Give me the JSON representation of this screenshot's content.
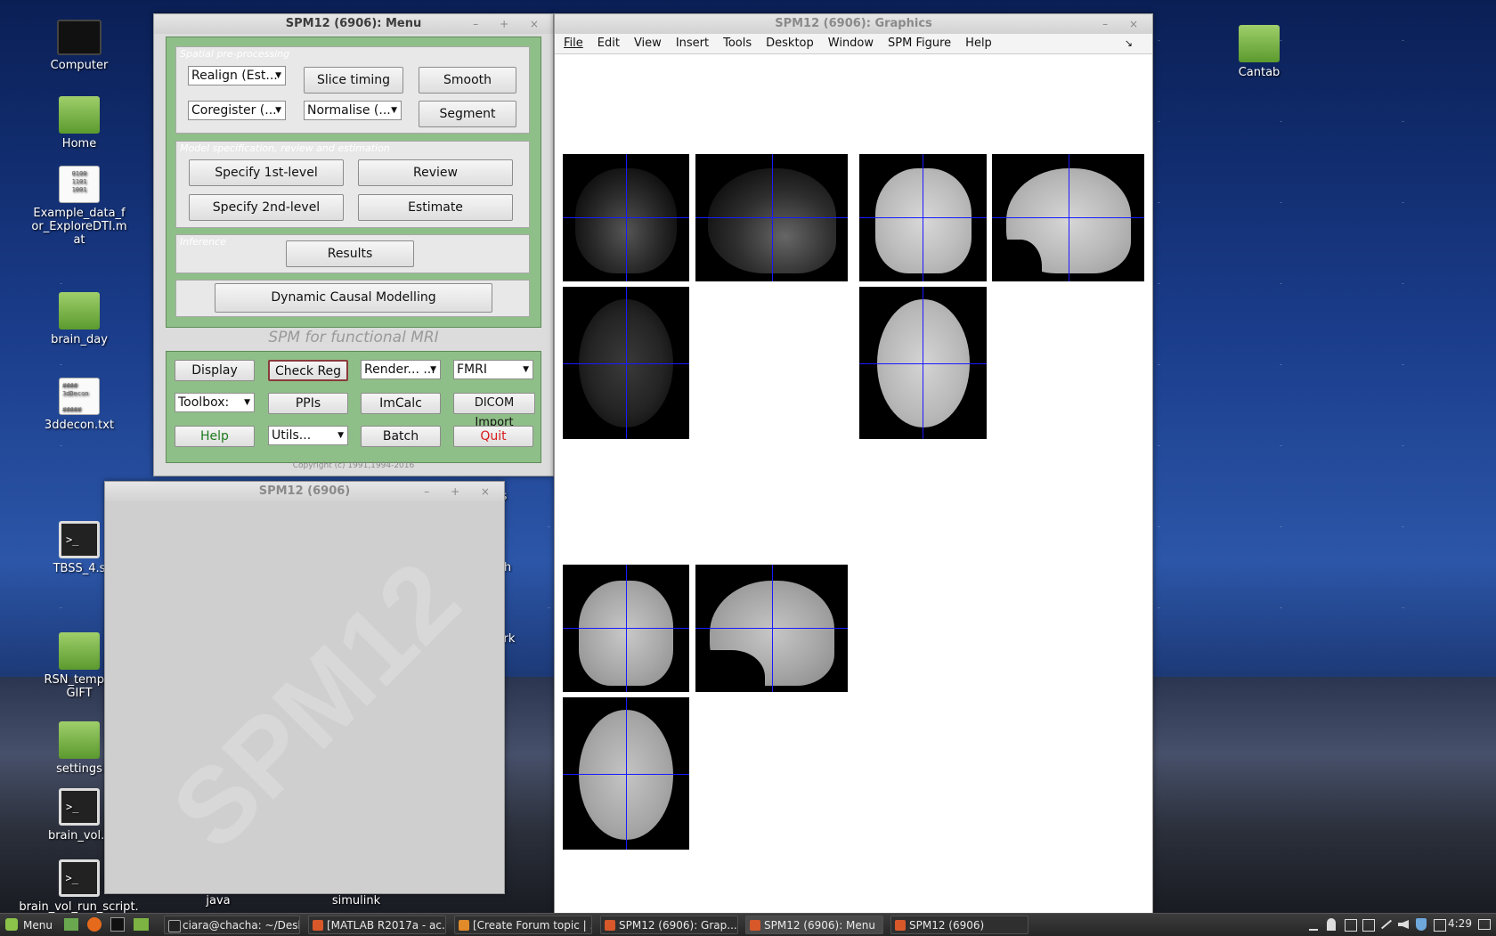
{
  "desktop": {
    "icons": [
      {
        "label": "Computer",
        "icon": "computer-icon"
      },
      {
        "label": "Home",
        "icon": "home-folder-icon"
      },
      {
        "label": "Example_data_for_ExploreDTI.mat",
        "icon": "data-file-icon"
      },
      {
        "label": "brain_day",
        "icon": "folder-icon"
      },
      {
        "label": "3ddecon.txt",
        "icon": "text-file-icon"
      },
      {
        "label": "TBSS_4.s",
        "icon": "terminal-script-icon"
      },
      {
        "label": "RSN_templa GIFT",
        "icon": "folder-icon"
      },
      {
        "label": "settings",
        "icon": "folder-icon"
      },
      {
        "label": "brain_vol.s",
        "icon": "terminal-script-icon"
      },
      {
        "label": "brain_vol_run_script.",
        "icon": "terminal-script-icon"
      },
      {
        "label": "Cantab",
        "icon": "folder-icon"
      },
      {
        "label": "java",
        "icon": "folder-icon"
      },
      {
        "label": "simulink",
        "icon": "folder-icon"
      }
    ],
    "partial_labels": [
      "es",
      "h",
      "ork"
    ],
    "doc_glyph_text": {
      "data": "0100\n1101\n1001",
      "txt": "####\n3dDecon\n\n#####"
    },
    "terminal_glyph": ">_"
  },
  "menu_window": {
    "title": "SPM12 (6906): Menu",
    "controls": "– + ×",
    "spatial": {
      "title": "Spatial pre-processing",
      "realign": "Realign (Est...",
      "slice_timing": "Slice timing",
      "smooth": "Smooth",
      "coregister": "Coregister (...",
      "normalise": "Normalise (...",
      "segment": "Segment"
    },
    "model": {
      "title": "Model specification, review and estimation",
      "specify1": "Specify 1st-level",
      "review": "Review",
      "specify2": "Specify 2nd-level",
      "estimate": "Estimate"
    },
    "inference": {
      "title": "Inference",
      "results": "Results"
    },
    "dcm": "Dynamic Causal Modelling",
    "subtitle": "SPM for functional MRI",
    "utilities": {
      "display": "Display",
      "check_reg": "Check Reg",
      "render": "Render... ...",
      "modality": "FMRI",
      "toolbox": "Toolbox:",
      "ppis": "PPIs",
      "imcalc": "ImCalc",
      "dicom": "DICOM Import",
      "help": "Help",
      "utils": "Utils...",
      "batch": "Batch",
      "quit": "Quit"
    },
    "copyright": "Copyright (c) 1991,1994-2016"
  },
  "interactive_window": {
    "title": "SPM12 (6906)",
    "controls": "– + ×",
    "watermark": "SPM12"
  },
  "graphics_window": {
    "title": "SPM12 (6906): Graphics",
    "controls": "– ×",
    "menu": [
      "File",
      "Edit",
      "View",
      "Insert",
      "Tools",
      "Desktop",
      "Window",
      "SPM Figure",
      "Help"
    ],
    "dock_glyph": "↘"
  },
  "taskbar": {
    "menu_label": "Menu",
    "tasks": [
      "ciara@chacha: ~/Desk...",
      "[MATLAB R2017a - ac...",
      "[Create Forum topic | ...",
      "SPM12 (6906): Grap...",
      "SPM12 (6906): Menu",
      "SPM12 (6906)"
    ],
    "clock": "4:29"
  },
  "colors": {
    "panel_green": "#8fbf88",
    "quit_red": "#d81b1b",
    "help_green": "#1d7a1d",
    "crosshair": "#1a1aff"
  }
}
